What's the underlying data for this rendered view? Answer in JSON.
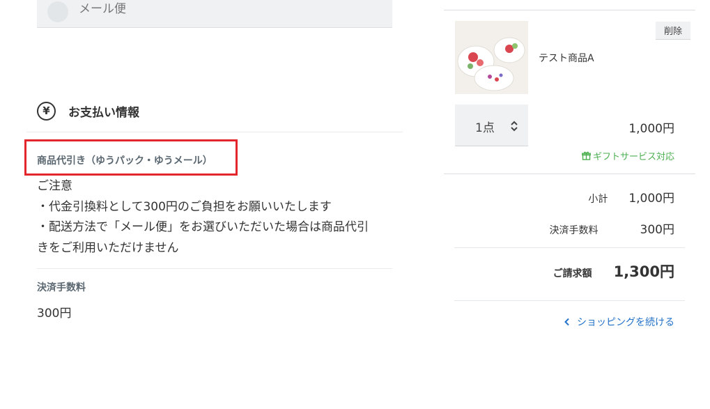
{
  "shipping": {
    "option_label": "メール便"
  },
  "payment": {
    "section_title": "お支払い情報",
    "icon": "yen-circle-icon",
    "method_name": "商品代引き（ゆうパック・ゆうメール）",
    "notice_lines": [
      "ご注意",
      "・代金引換料として300円のご負担をお願いいたします",
      "・配送方法で「メール便」をお選びいただいた場合は商品代引",
      "きをご利用いただけません"
    ],
    "fee_label": "決済手数料",
    "fee_value": "300円",
    "highlight_color": "#e2262b"
  },
  "cart": {
    "item": {
      "name": "テスト商品A",
      "delete_label": "削除",
      "quantity": "1点",
      "price": "1,000円",
      "gift_label": "ギフトサービス対応",
      "image_icon": "teacup-plates-image"
    },
    "summary": {
      "subtotal_label": "小計",
      "subtotal_value": "1,000円",
      "fee_label": "決済手数料",
      "fee_value": "300円",
      "total_label": "ご請求額",
      "total_value": "1,300円"
    },
    "continue_label": "ショッピングを続ける",
    "gift_color": "#4caf50",
    "link_color": "#2372c9"
  }
}
